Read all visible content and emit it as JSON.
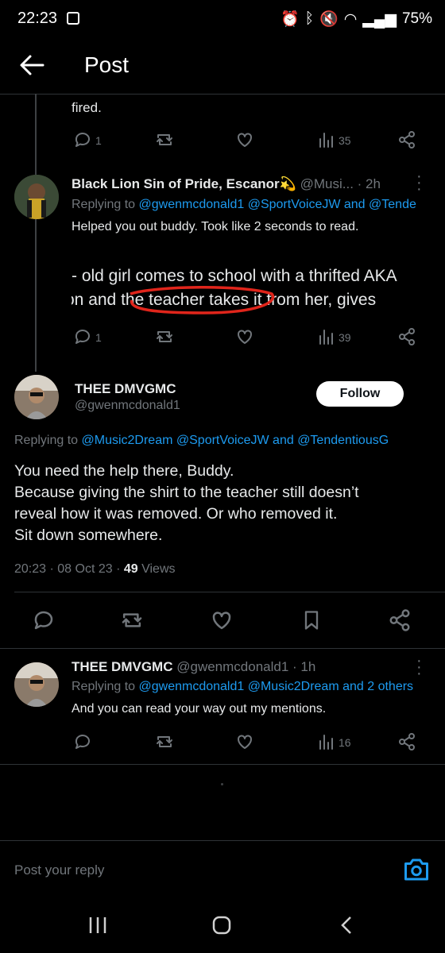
{
  "status_bar": {
    "time": "22:23",
    "battery": "75%"
  },
  "header": {
    "title": "Post"
  },
  "tweet_prev": {
    "text_tail": "fired.",
    "reply_count": "1",
    "views": "35"
  },
  "reply_escanor": {
    "name": "Black Lion Sin of Pride, Escanor",
    "name_emoji": "💫",
    "handle": "@Musi...",
    "time": "· 2h",
    "replying_prefix": "Replying to",
    "replying_to": "@gwenmcdonald1 @SportVoiceJW and @Tende",
    "text": "Helped you out buddy. Took like 2 seconds to read.",
    "image_line1": "- old girl comes to school with a thrifted AKA",
    "image_line2a": "on and ",
    "image_line2b": "the teacher takes",
    "image_line2c": " it from her, gives",
    "reply_count": "1",
    "views": "39"
  },
  "main_post": {
    "name": "THEE DMVGMC",
    "handle": "@gwenmcdonald1",
    "follow_label": "Follow",
    "replying_prefix": "Replying to",
    "replying_to": "@Music2Dream @SportVoiceJW and @TendentiousG",
    "lines": [
      "You need the help there, Buddy.",
      "Because giving the shirt to the teacher still doesn’t",
      "reveal how it was removed. Or who removed it.",
      "Sit down somewhere."
    ],
    "timestamp": "20:23 · 08 Oct 23 · ",
    "views_count": "49",
    "views_label": " Views"
  },
  "reply_thee": {
    "name": "THEE DMVGMC",
    "handle": "@gwenmcdonald1",
    "time": "· 1h",
    "replying_prefix": "Replying to",
    "replying_to": "@gwenmcdonald1 @Music2Dream and 2 others",
    "text": "And you can read your way out my mentions.",
    "views": "16"
  },
  "reply_box": {
    "placeholder": "Post your reply"
  },
  "colors": {
    "accent": "#1d9bf0",
    "background": "#000000",
    "muted": "#71767b"
  }
}
